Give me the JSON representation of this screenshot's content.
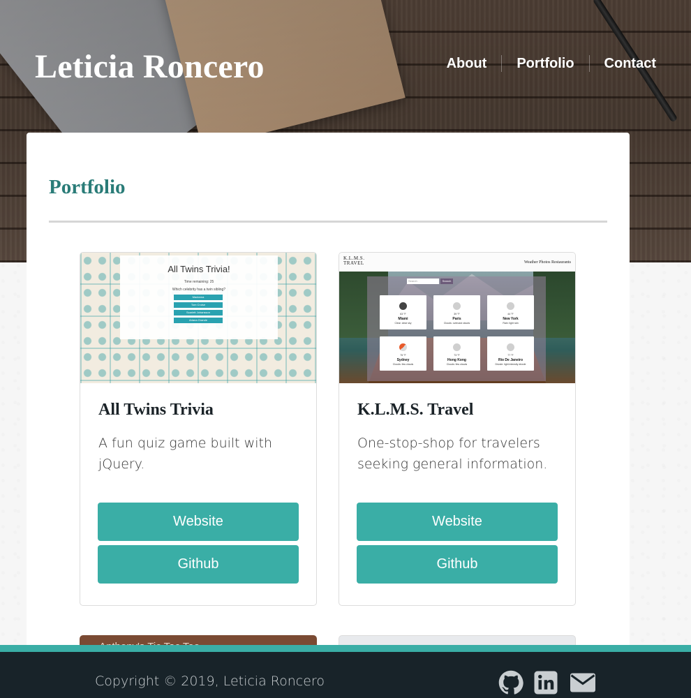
{
  "header": {
    "site_title": "Leticia Roncero",
    "nav": [
      {
        "label": "About"
      },
      {
        "label": "Portfolio"
      },
      {
        "label": "Contact"
      }
    ]
  },
  "main": {
    "section_title": "Portfolio",
    "projects": [
      {
        "title": "All Twins Trivia",
        "description": "A fun quiz game built with jQuery.",
        "website_label": "Website",
        "github_label": "Github",
        "thumbnail": {
          "heading": "All Twins Trivia!",
          "timer": "Time remaining: 25",
          "question": "Which celebrity has a twin sibling?",
          "options": [
            "Madonna",
            "Tom Cruise",
            "Scarlett Johansson",
            "Ariana Grande"
          ]
        }
      },
      {
        "title": "K.L.M.S. Travel",
        "description": "One-stop-shop for travelers seeking general information.",
        "website_label": "Website",
        "github_label": "Github",
        "thumbnail": {
          "logo_line1": "K.L.M.S.",
          "logo_line2": "TRAVEL",
          "nav": "Weather  Photos  Restaurants",
          "search_placeholder": "Search",
          "search_button": "Search",
          "cities": [
            {
              "temp": "63 °F",
              "city": "Miami",
              "condition": "Clear: clear sky",
              "icon": "moon-icon"
            },
            {
              "temp": "39 °F",
              "city": "Paris",
              "condition": "Clouds: overcast clouds",
              "icon": "cloud-icon"
            },
            {
              "temp": "44 °F",
              "city": "New York",
              "condition": "Rain: light rain",
              "icon": "rain-icon"
            },
            {
              "temp": "75 °F",
              "city": "Sydney",
              "condition": "Clouds: few clouds",
              "icon": "partly-cloudy-icon"
            },
            {
              "temp": "73 °F",
              "city": "Hong Kong",
              "condition": "Clouds: few clouds",
              "icon": "cloud-icon"
            },
            {
              "temp": "77 °F",
              "city": "Rio De Janeiro",
              "condition": "Drizzle: light intensity drizzle",
              "icon": "rain-icon"
            }
          ]
        }
      }
    ],
    "peek_card_text": "Anthony's Tic Tac Toe"
  },
  "footer": {
    "copyright": "Copyright © 2019, Leticia Roncero",
    "icons": [
      "github-icon",
      "linkedin-icon",
      "email-icon"
    ]
  },
  "colors": {
    "accent": "#3aaea6",
    "section_title": "#2a7c78",
    "footer_bg": "#182329"
  }
}
